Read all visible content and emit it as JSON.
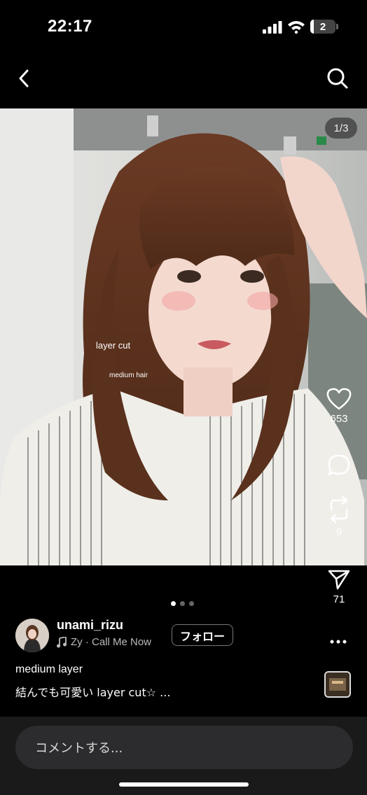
{
  "status_bar": {
    "time": "22:17",
    "battery_level": "2"
  },
  "nav": {
    "back_icon": "chevron-left-icon",
    "search_icon": "search-icon"
  },
  "post": {
    "image_counter": "1/3",
    "overlay_text_1": "layer cut",
    "overlay_text_2": "medium hair",
    "page_count": 3,
    "active_page": 1
  },
  "actions": {
    "like_count": "653",
    "comment_count": "",
    "repost_count": "9",
    "share_count": "71"
  },
  "author": {
    "username": "unami_rizu",
    "music": "Zy · Call Me Now",
    "follow_label": "フォロー"
  },
  "caption": {
    "title": "medium layer",
    "body": "結んでも可愛い layer cut☆ ..."
  },
  "comment": {
    "placeholder": "コメントする..."
  },
  "colors": {
    "background": "#000000",
    "input_bg": "#2c2c2e",
    "muted_text": "#bbbbbb"
  }
}
